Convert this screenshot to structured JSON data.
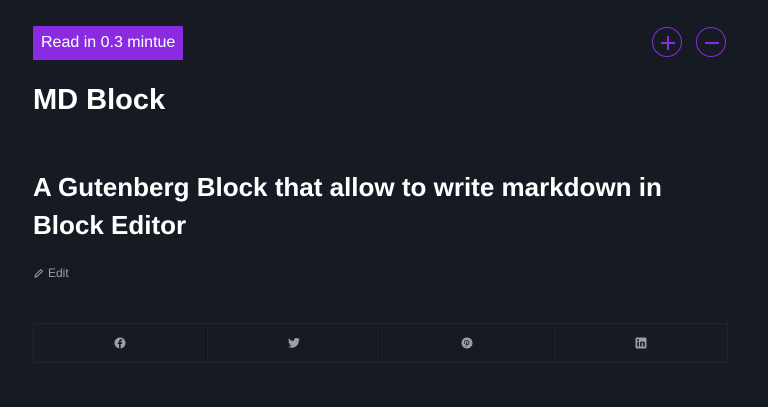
{
  "badge": {
    "read_time": "Read in 0.3 mintue"
  },
  "zoom": {
    "increase_icon": "plus-icon",
    "decrease_icon": "minus-icon",
    "accent_color": "#8a2be2"
  },
  "site": {
    "title": "MD Block"
  },
  "post": {
    "heading": "A Gutenberg Block that allow to write markdown in Block Editor",
    "edit_label": "Edit",
    "edit_icon": "pencil-icon"
  },
  "share": {
    "items": [
      {
        "name": "facebook",
        "icon": "facebook-icon"
      },
      {
        "name": "twitter",
        "icon": "twitter-icon"
      },
      {
        "name": "pinterest",
        "icon": "pinterest-icon"
      },
      {
        "name": "linkedin",
        "icon": "linkedin-icon"
      }
    ]
  },
  "colors": {
    "background": "#161a22",
    "text": "#ffffff",
    "muted": "#9aa0a8",
    "accent": "#8a2be2"
  }
}
